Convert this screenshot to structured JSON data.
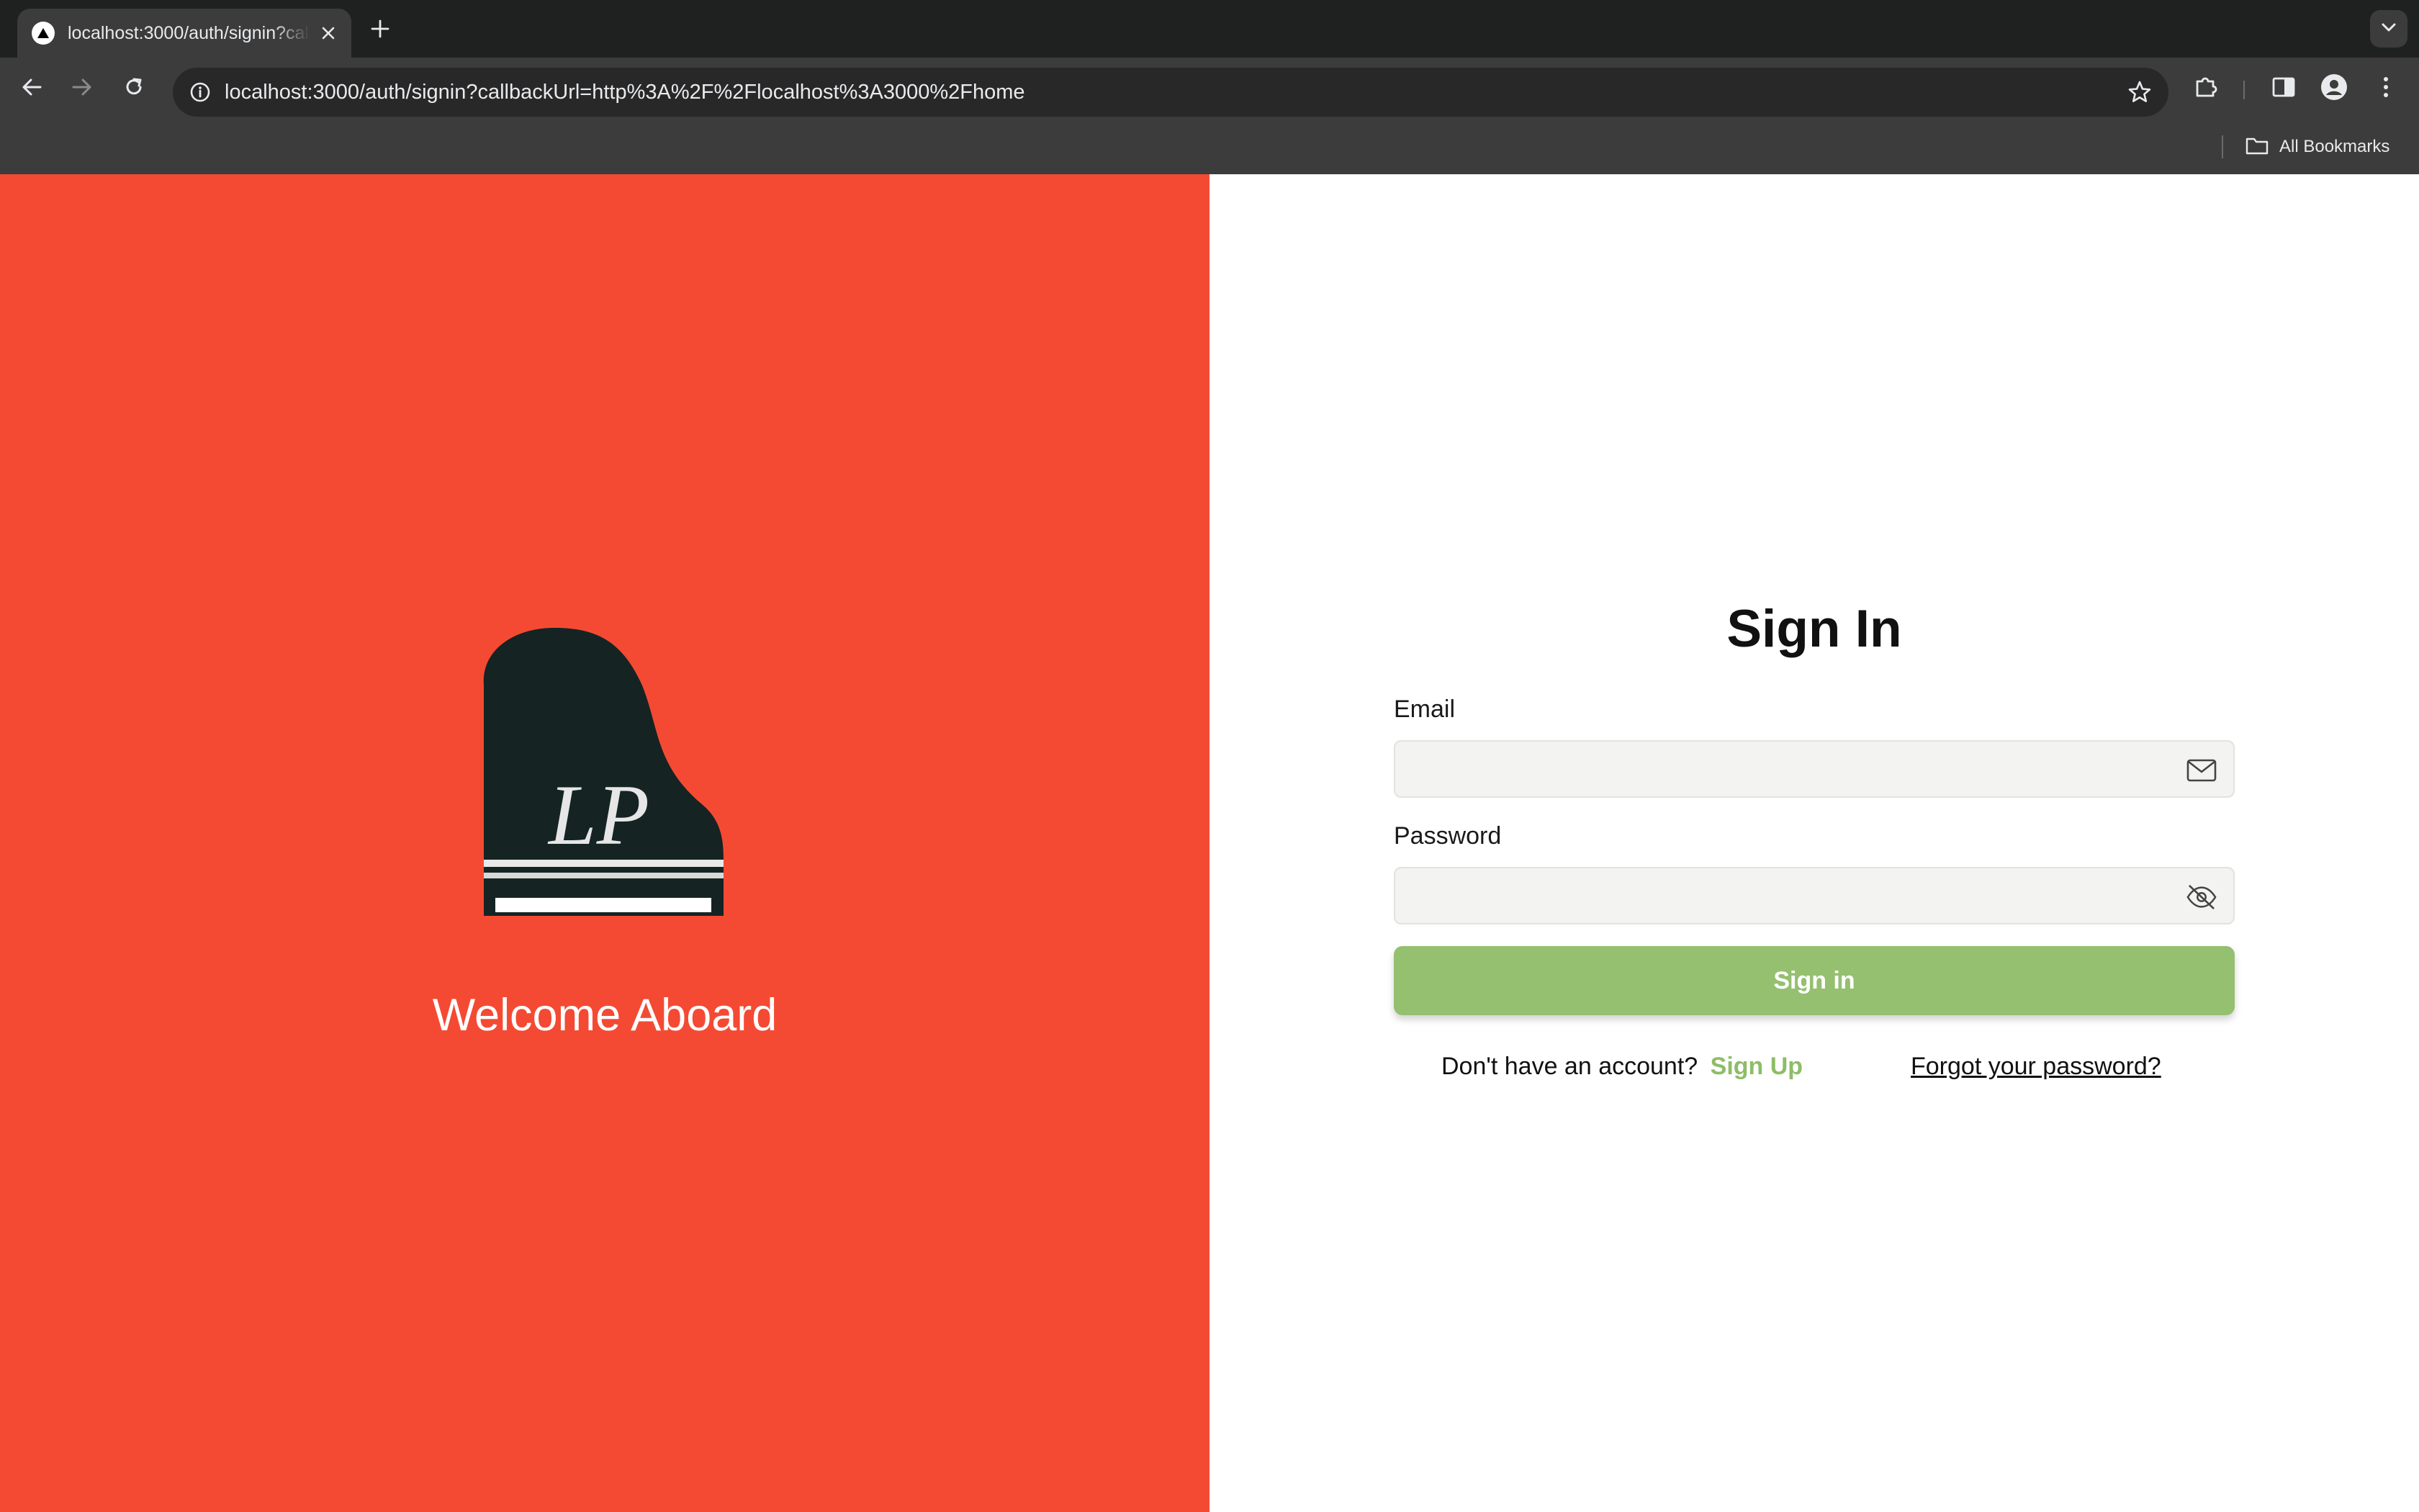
{
  "browser": {
    "tab": {
      "title": "localhost:3000/auth/signin?callbackUrl=http%3A%2F%2Flocalhost%3A3000%2Fhome",
      "favicon": "triangle-icon"
    },
    "url": "localhost:3000/auth/signin?callbackUrl=http%3A%2F%2Flocalhost%3A3000%2Fhome",
    "bookmarks": {
      "all_bookmarks_label": "All Bookmarks"
    }
  },
  "brand": {
    "logo_text": "LP",
    "welcome": "Welcome Aboard",
    "background_color": "#f44a33"
  },
  "form": {
    "title": "Sign In",
    "email": {
      "label": "Email",
      "value": "",
      "icon": "mail-icon"
    },
    "password": {
      "label": "Password",
      "value": "",
      "icon": "eye-off-icon"
    },
    "submit_label": "Sign in",
    "no_account_text": "Don't have an account?",
    "signup_label": "Sign Up",
    "forgot_label": "Forgot your password?",
    "accent_color": "#94c06f"
  }
}
